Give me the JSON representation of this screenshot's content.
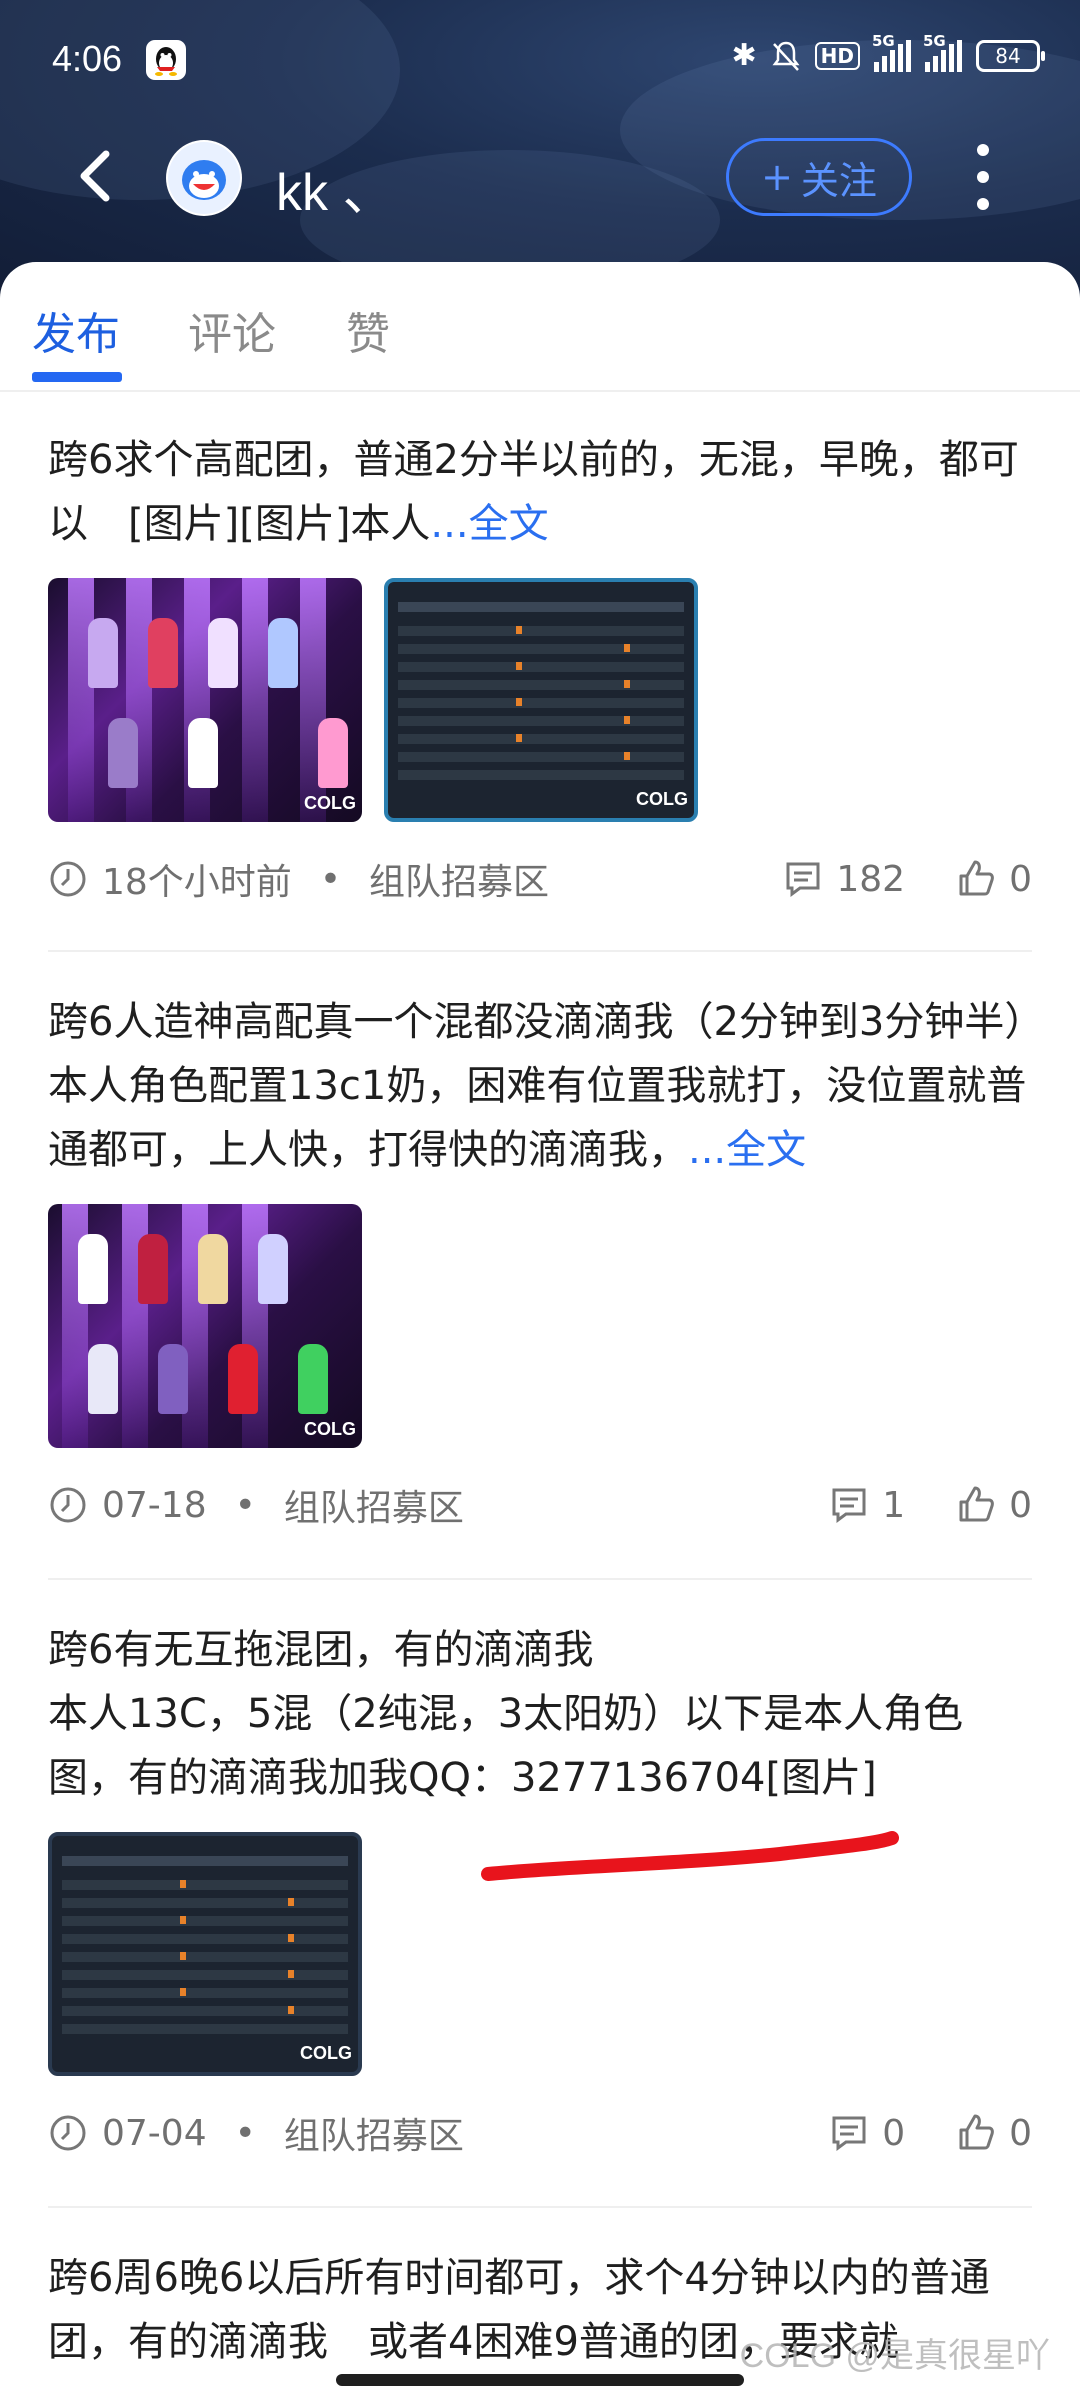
{
  "status_bar": {
    "time": "4:06",
    "hd": "HD",
    "net1": "5G",
    "net2": "5G",
    "battery": "84"
  },
  "header": {
    "username": "kk 、",
    "follow_plus": "+",
    "follow_label": "关注"
  },
  "tabs": [
    {
      "label": "发布",
      "active": true
    },
    {
      "label": "评论",
      "active": false
    },
    {
      "label": "赞",
      "active": false
    }
  ],
  "posts": [
    {
      "text": "跨6求个高配团，普通2分半以前的，无混，早晚，都可以　[图片][图片]本人",
      "more": "...全文",
      "time": "18个小时前",
      "sep": "•",
      "category": "组队招募区",
      "comments": "182",
      "likes": "0"
    },
    {
      "text": "跨6人造神高配真一个混都没滴滴我（2分钟到3分钟半）　本人角色配置13c1奶，困难有位置我就打，没位置就普通都可，上人快，打得快的滴滴我，",
      "more": "...全文",
      "time": "07-18",
      "sep": "•",
      "category": "组队招募区",
      "comments": "1",
      "likes": "0"
    },
    {
      "text": "跨6有无互拖混团，有的滴滴我\n本人13C，5混（2纯混，3太阳奶）以下是本人角色图，有的滴滴我加我QQ：3277136704[图片]",
      "more": "",
      "time": "07-04",
      "sep": "•",
      "category": "组队招募区",
      "comments": "0",
      "likes": "0"
    },
    {
      "text": "跨6周6晚6以后所有时间都可，求个4分钟以内的普通团，有的滴滴我　或者4困难9普通的团，要求就",
      "more": ""
    }
  ],
  "watermark": "COLG @是真很星吖",
  "colors": {
    "accent": "#2468f2",
    "header_bg": "#1b2c4d",
    "red_mark": "#e8141c"
  },
  "icons": [
    "back-icon",
    "qq-icon",
    "bluetooth-icon",
    "mute-icon",
    "clock-icon",
    "comment-icon",
    "thumbs-up-icon",
    "more-icon"
  ]
}
